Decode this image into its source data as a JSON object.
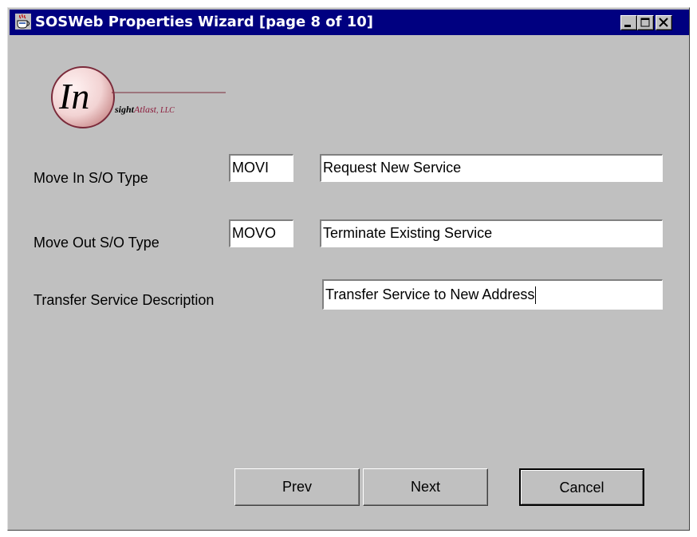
{
  "window": {
    "title": "SOSWeb Properties Wizard  [page 8 of 10]"
  },
  "titlebar_buttons": {
    "minimize_icon": "minimize-icon",
    "maximize_icon": "maximize-icon",
    "close_icon": "close-icon"
  },
  "logo": {
    "initials": "In",
    "tail_text": "sight",
    "accent_text": "Atlast",
    "suffix_text": ", LLC",
    "accent_color": "#8b1a3a"
  },
  "form": {
    "move_in": {
      "label": "Move In S/O Type",
      "code": "MOVI",
      "description": "Request New Service"
    },
    "move_out": {
      "label": "Move Out S/O Type",
      "code": "MOVO",
      "description": "Terminate Existing Service"
    },
    "transfer": {
      "label": "Transfer Service Description",
      "description": "Transfer Service to New Address"
    }
  },
  "buttons": {
    "prev": "Prev",
    "next": "Next",
    "cancel": "Cancel"
  },
  "colors": {
    "titlebar": "#000080",
    "window_bg": "#c0c0c0"
  }
}
